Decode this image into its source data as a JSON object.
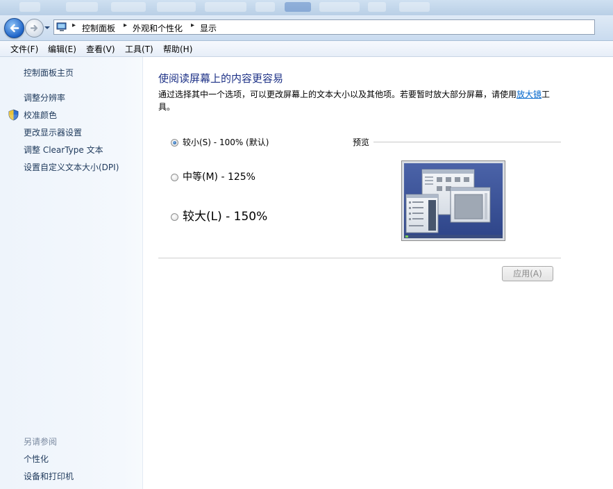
{
  "breadcrumb": {
    "items": [
      "控制面板",
      "外观和个性化",
      "显示"
    ],
    "separator": "▸"
  },
  "menubar": {
    "items": [
      "文件(F)",
      "编辑(E)",
      "查看(V)",
      "工具(T)",
      "帮助(H)"
    ]
  },
  "leftpane": {
    "home": "控制面板主页",
    "links": [
      "调整分辨率",
      "校准颜色",
      "更改显示器设置",
      "调整 ClearType 文本",
      "设置自定义文本大小(DPI)"
    ],
    "see_also_header": "另请参阅",
    "see_also": [
      "个性化",
      "设备和打印机"
    ]
  },
  "main": {
    "title": "使阅读屏幕上的内容更容易",
    "description": "通过选择其中一个选项，可以更改屏幕上的文本大小以及其他项。若要暂时放大部分屏幕，请使用",
    "description_link": "放大镜",
    "description_tail": "工具。",
    "options": [
      {
        "label": "较小(S) - 100% (默认)",
        "checked": true
      },
      {
        "label": "中等(M) - 125%",
        "checked": false
      },
      {
        "label": "较大(L) - 150%",
        "checked": false
      }
    ],
    "preview_label": "预览",
    "apply_label": "应用(A)"
  },
  "colors": {
    "link": "#1e395b",
    "title": "#1e3287",
    "hyperlink": "#0066cc"
  }
}
